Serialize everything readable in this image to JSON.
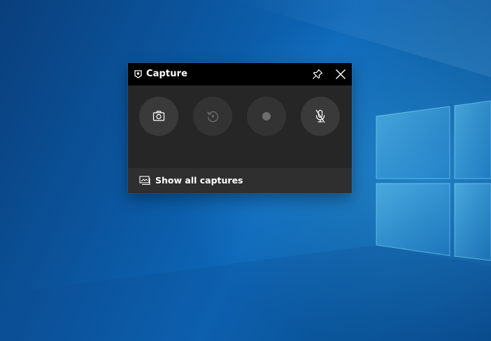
{
  "widget": {
    "title": "Capture",
    "title_icon": "capture-widget-icon",
    "pin_icon": "pin-icon",
    "close_icon": "close-icon"
  },
  "controls": [
    {
      "name": "screenshot-button",
      "icon": "camera-icon",
      "enabled": true
    },
    {
      "name": "record-last-30-seconds-button",
      "icon": "history-icon",
      "enabled": false
    },
    {
      "name": "start-recording-button",
      "icon": "record-dot-icon",
      "enabled": false
    },
    {
      "name": "microphone-toggle-button",
      "icon": "microphone-off-icon",
      "enabled": true
    }
  ],
  "footer": {
    "label": "Show all captures",
    "icon": "gallery-icon"
  },
  "colors": {
    "titlebar": "#000000",
    "panel": "#262626",
    "footer": "#2f2f2f",
    "button": "#3a3a3a",
    "button_disabled": "#333333",
    "desktop": "#0b5aa5"
  }
}
